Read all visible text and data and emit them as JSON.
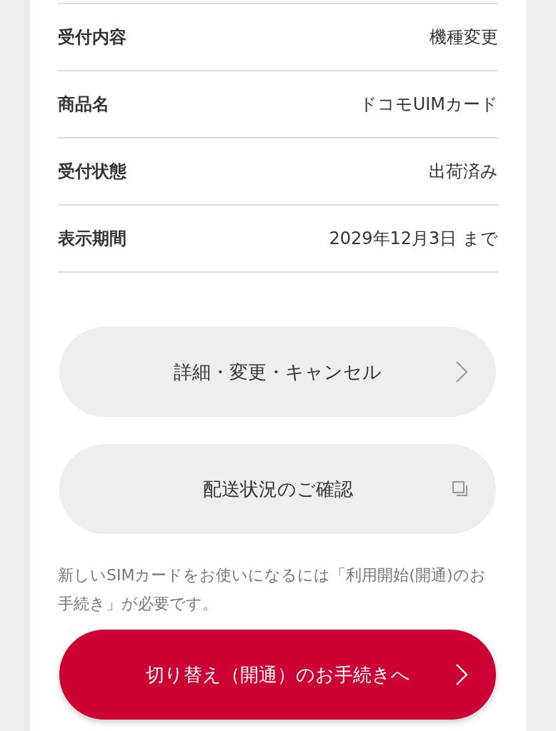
{
  "details": [
    {
      "label": "受付内容",
      "value": "機種変更"
    },
    {
      "label": "商品名",
      "value": "ドコモUIMカード"
    },
    {
      "label": "受付状態",
      "value": "出荷済み"
    },
    {
      "label": "表示期間",
      "value": "2029年12月3日 まで"
    }
  ],
  "buttons": [
    {
      "label": "詳細・変更・キャンセル",
      "kind": "chevron"
    },
    {
      "label": "配送状況のご確認",
      "kind": "external"
    }
  ],
  "note": "新しいSIMカードをお使いになるには「利用開始(開通)のお手続き」が必要です。",
  "primary_button": {
    "label": "切り替え（開通）のお手続きへ"
  }
}
